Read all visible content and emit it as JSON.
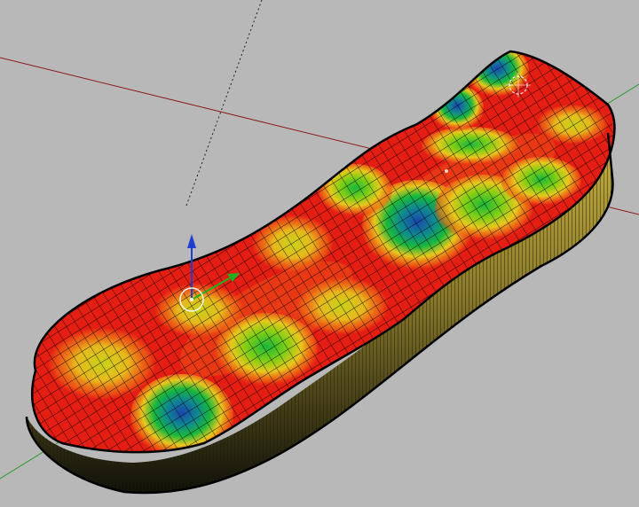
{
  "viewport": {
    "background": "#b8b8b8",
    "axis_x_color": "#8b1a1a",
    "axis_y_color": "#2e9b2e",
    "axis_z_color": "#202020",
    "gizmo_up_color": "#1f3fd0",
    "gizmo_side_color": "#20b020",
    "gizmo_ring_color": "#ffffff",
    "mesh_wire_color": "#000000",
    "heat_colors": [
      "#e51e14",
      "#f06a14",
      "#e8c81c",
      "#7fcf14",
      "#18b83c",
      "#0f8a8f",
      "#1a45b0"
    ]
  },
  "model": {
    "name": "insole-heatmap-mesh"
  }
}
